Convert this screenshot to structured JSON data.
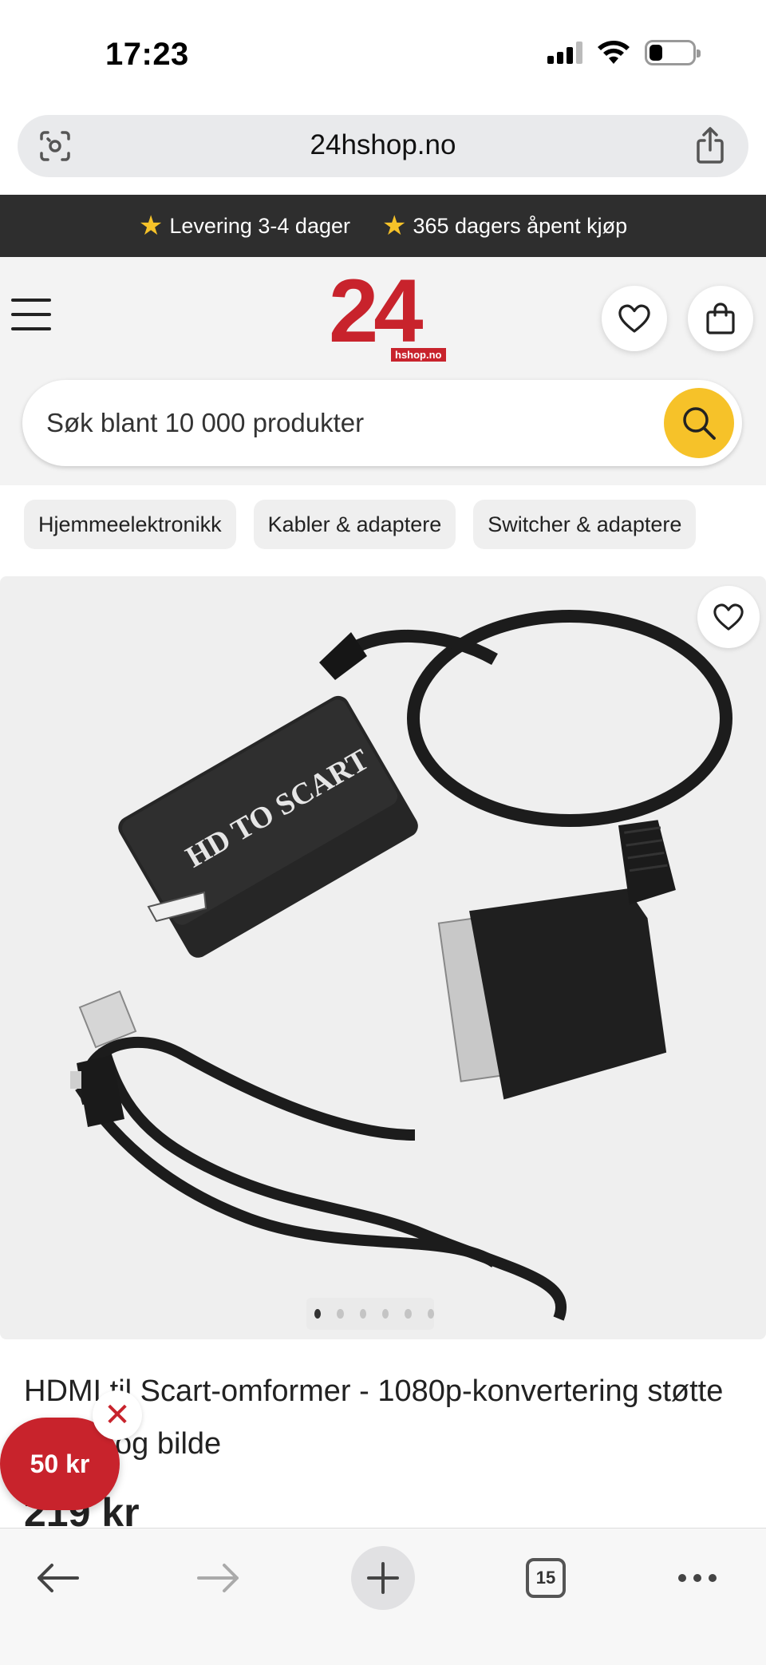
{
  "status": {
    "time": "17:23"
  },
  "browser": {
    "url": "24hshop.no"
  },
  "promo": [
    {
      "text": "Levering 3-4 dager"
    },
    {
      "text": "365 dagers åpent kjøp"
    }
  ],
  "logo": {
    "number": "24",
    "sub": "hshop.no"
  },
  "search": {
    "placeholder": "Søk blant 10 000 produkter"
  },
  "chips": [
    "Hjemmeelektronikk",
    "Kabler & adaptere",
    "Switcher & adaptere"
  ],
  "product": {
    "image_text": "HD TO SCART",
    "image_dots": 6,
    "active_dot": 0,
    "title": "HDMI til Scart-omformer - 1080p-konvertering støtte for lyd og bilde",
    "price": "219 kr"
  },
  "badge": {
    "label": "50 kr"
  },
  "toolbar": {
    "tab_count": "15"
  },
  "colors": {
    "brand_red": "#c8232c",
    "accent_yellow": "#f6c229",
    "promo_bg": "#2e2e2e"
  }
}
